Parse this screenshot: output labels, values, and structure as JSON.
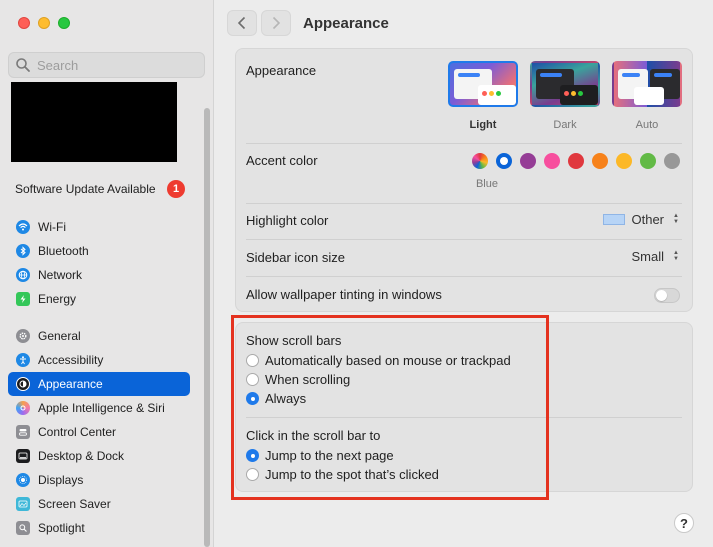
{
  "search": {
    "placeholder": "Search"
  },
  "sidebar": {
    "update_label": "Software Update Available",
    "update_count": "1",
    "group1": [
      {
        "label": "Wi-Fi",
        "color": "#1e88e5"
      },
      {
        "label": "Bluetooth",
        "color": "#1e88e5"
      },
      {
        "label": "Network",
        "color": "#1e88e5"
      },
      {
        "label": "Energy",
        "color": "#34c759"
      }
    ],
    "group2": [
      {
        "label": "General",
        "color": "#8e8e93"
      },
      {
        "label": "Accessibility",
        "color": "#1e88e5"
      },
      {
        "label": "Appearance",
        "color": "#1c1c1e"
      },
      {
        "label": "Apple Intelligence & Siri",
        "color": "#f27aa8"
      },
      {
        "label": "Control Center",
        "color": "#8e8e93"
      },
      {
        "label": "Desktop & Dock",
        "color": "#1c1c1e"
      },
      {
        "label": "Displays",
        "color": "#1e88e5"
      },
      {
        "label": "Screen Saver",
        "color": "#3fb8d8"
      },
      {
        "label": "Spotlight",
        "color": "#8e8e93"
      }
    ]
  },
  "header": {
    "title": "Appearance"
  },
  "appearance": {
    "label": "Appearance",
    "options": [
      {
        "label": "Light",
        "selected": true
      },
      {
        "label": "Dark",
        "selected": false
      },
      {
        "label": "Auto",
        "selected": false
      }
    ]
  },
  "accent": {
    "label": "Accent color",
    "caption": "Blue",
    "colors": [
      "multicolor",
      "#0a64d8",
      "#953d96",
      "#f74f9e",
      "#e0383e",
      "#f7821b",
      "#fcb827",
      "#62ba46",
      "#989898"
    ],
    "selected_index": 1
  },
  "highlight": {
    "label": "Highlight color",
    "value": "Other"
  },
  "icon_size": {
    "label": "Sidebar icon size",
    "value": "Small"
  },
  "tinting": {
    "label": "Allow wallpaper tinting in windows",
    "on": false
  },
  "scroll_bars": {
    "label": "Show scroll bars",
    "options": [
      "Automatically based on mouse or trackpad",
      "When scrolling",
      "Always"
    ],
    "selected": 2
  },
  "click_bar": {
    "label": "Click in the scroll bar to",
    "options": [
      "Jump to the next page",
      "Jump to the spot that’s clicked"
    ],
    "selected": 0
  },
  "help_label": "?"
}
